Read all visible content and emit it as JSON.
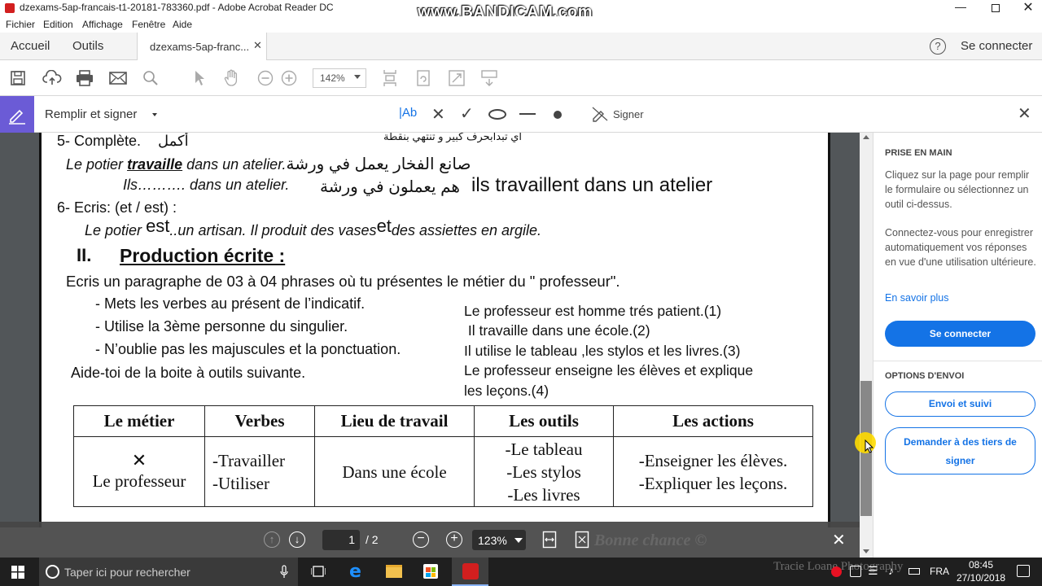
{
  "window": {
    "title": "dzexams-5ap-francais-t1-20181-783360.pdf - Adobe Acrobat Reader DC",
    "watermark": "www.BANDICAM.com"
  },
  "menu": [
    "Fichier",
    "Edition",
    "Affichage",
    "Fenêtre",
    "Aide"
  ],
  "tabs": {
    "home": "Accueil",
    "tools": "Outils",
    "doc": "dzexams-5ap-franc...",
    "help": "?",
    "connect": "Se connecter"
  },
  "toolbar": {
    "zoom": "142%"
  },
  "fillsign": {
    "title": "Remplir et signer",
    "text_tool": "Ab",
    "sign": "Signer"
  },
  "document": {
    "q5_title": "5- Complète.",
    "q5_ar": "أكمل",
    "q5_ar_note": "اي تبدابحرف كبير و تنتهي بنقطة",
    "q5_line1_a": "Le potier ",
    "q5_line1_b": "travaille",
    "q5_line1_c": " dans un atelier.",
    "q5_line1_ar": "صانع الفخار يعمل في ورشة",
    "q5_line2": "Ils………. dans un atelier.",
    "q5_line2_ar": "هم يعملون في ورشة",
    "q5_answer": "ils travaillent dans un atelier",
    "q6_title": "6- Ecris: (et / est) :",
    "q6_line_a": "Le potier ",
    "q6_hand1": "est",
    "q6_line_b": "..un artisan. Il produit des vases",
    "q6_hand2": "et",
    "q6_line_c": "des assiettes en argile.",
    "section_num": "II.",
    "section_title": "Production écrite :",
    "instruction": "Ecris un paragraphe de 03 à 04 phrases où tu présentes le métier du \" professeur\".",
    "bullets": [
      "- Mets les verbes au présent de l’indicatif.",
      "- Utilise la 3ème personne du singulier.",
      "- N’oublie pas les majuscules et la ponctuation."
    ],
    "aide": "Aide-toi de la boite à outils suivante.",
    "answers": [
      "Le professeur est homme trés patient.(1)",
      " Il travaille dans une école.(2)",
      "Il utilise le tableau ,les stylos et les livres.(3)",
      "Le professeur enseigne les élèves et explique",
      "les leçons.(4)"
    ],
    "table": {
      "headers": [
        "Le métier",
        "Verbes",
        "Lieu de travail",
        "Les outils",
        "Les actions"
      ],
      "mark": "✕",
      "job": "Le professeur",
      "verbs": [
        "-Travailler",
        "-Utiliser"
      ],
      "place": "Dans une école",
      "tools": [
        "-Le tableau",
        "-Les stylos",
        "-Les livres"
      ],
      "actions": [
        "-Enseigner les élèves.",
        "-Expliquer les leçons."
      ]
    },
    "footer_faint": "Bonne chance ©"
  },
  "floatbar": {
    "page_current": "1",
    "page_total": "/ 2",
    "zoom": "123%"
  },
  "rightpanel": {
    "getting_started": "PRISE EN MAIN",
    "desc1": "Cliquez sur la page pour remplir le formulaire ou sélectionnez un outil ci-dessus.",
    "desc2": "Connectez-vous pour enregistrer automatiquement vos réponses en vue d'une utilisation ultérieure.",
    "learn_more": "En savoir plus",
    "connect_btn": "Se connecter",
    "send_options": "OPTIONS D'ENVOI",
    "send_track": "Envoi et suivi",
    "request_sign": "Demander à des tiers de signer"
  },
  "taskbar": {
    "search_placeholder": "Taper ici pour rechercher",
    "watermark": "Tracie Loane Photography",
    "lang": "FRA",
    "time": "08:45",
    "date": "27/10/2018"
  },
  "colors": {
    "accent": "#1473e6",
    "taskbar": "#1f1f1f",
    "floatbar": "#464646"
  }
}
